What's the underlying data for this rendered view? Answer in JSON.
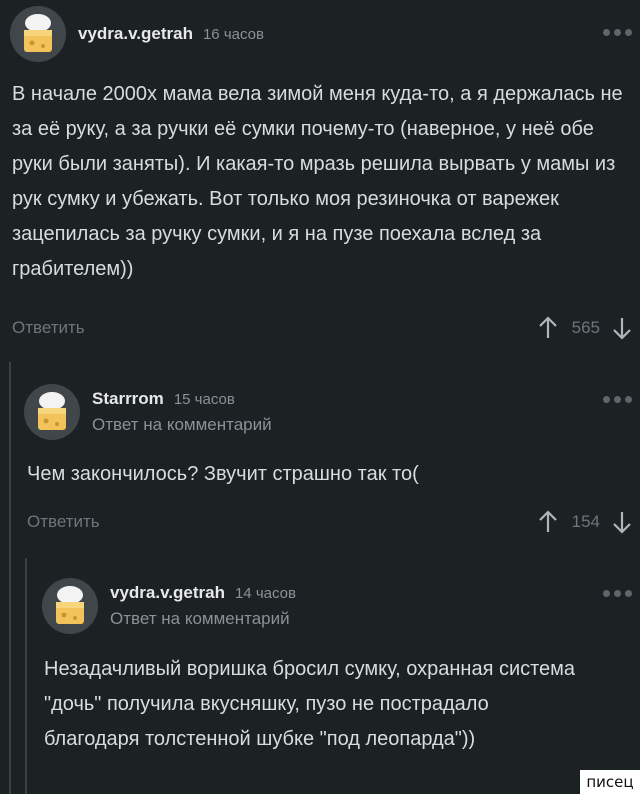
{
  "comments": [
    {
      "username": "vydra.v.getrah",
      "time": "16 часов",
      "reply_to": "",
      "text": "В начале 2000х мама вела зимой меня куда-то, а я держалась не за её руку, а за ручки её сумки почему-то (наверное, у неё обе руки были заняты). И какая-то мразь решила вырвать у мамы из рук сумку и убежать. Вот только моя резиночка от варежек зацепилась за ручку сумки, и я на пузе поехала вслед за грабителем))",
      "reply_label": "Ответить",
      "votes": "565"
    },
    {
      "username": "Starrrom",
      "time": "15 часов",
      "reply_to": "Ответ на комментарий",
      "text": "Чем закончилось? Звучит страшно так то(",
      "reply_label": "Ответить",
      "votes": "154"
    },
    {
      "username": "vydra.v.getrah",
      "time": "14 часов",
      "reply_to": "Ответ на комментарий",
      "text": "Незадачливый воришка бросил сумку, охранная система \"дочь\" получила вкусняшку, пузо не пострадало благодаря толстенной шубке \"под леопарда\"))",
      "reply_label": "",
      "votes": ""
    }
  ],
  "watermark": "писец",
  "icons": {
    "avatar": "cheese-chef-avatar-icon",
    "upvote": "arrow-up-icon",
    "downvote": "arrow-down-icon",
    "more": "more-dots-icon"
  },
  "colors": {
    "background": "#1c2124",
    "text": "#d9dcde",
    "muted": "#8b9196"
  }
}
